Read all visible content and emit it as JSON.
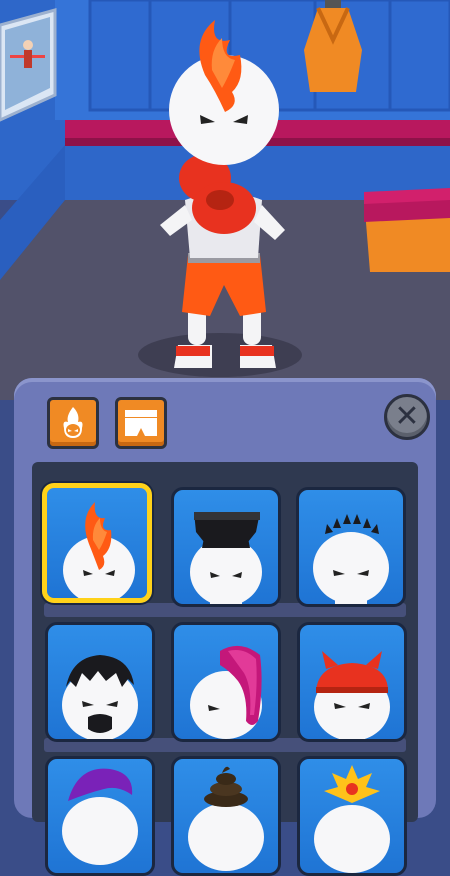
{
  "colors": {
    "panel": "#6e79b8",
    "card_bg": "#2f8ee8",
    "selected_border": "#ffd21a",
    "tab_orange": "#f08a24"
  },
  "tabs": [
    {
      "name": "hair-tab",
      "icon": "hair-flame-icon",
      "active": true
    },
    {
      "name": "shorts-tab",
      "icon": "shorts-icon",
      "active": false
    }
  ],
  "close_button": {
    "icon": "close-icon",
    "glyph": "✕"
  },
  "hairstyles": [
    {
      "id": "flame-mohawk",
      "selected": true
    },
    {
      "id": "flat-top",
      "selected": false
    },
    {
      "id": "spiky-crown",
      "selected": false
    },
    {
      "id": "black-hair-beard",
      "selected": false
    },
    {
      "id": "pink-emo",
      "selected": false
    },
    {
      "id": "red-devil-cap",
      "selected": false
    },
    {
      "id": "purple-hair",
      "selected": false
    },
    {
      "id": "poop-hat",
      "selected": false
    },
    {
      "id": "gold-crown",
      "selected": false
    }
  ]
}
